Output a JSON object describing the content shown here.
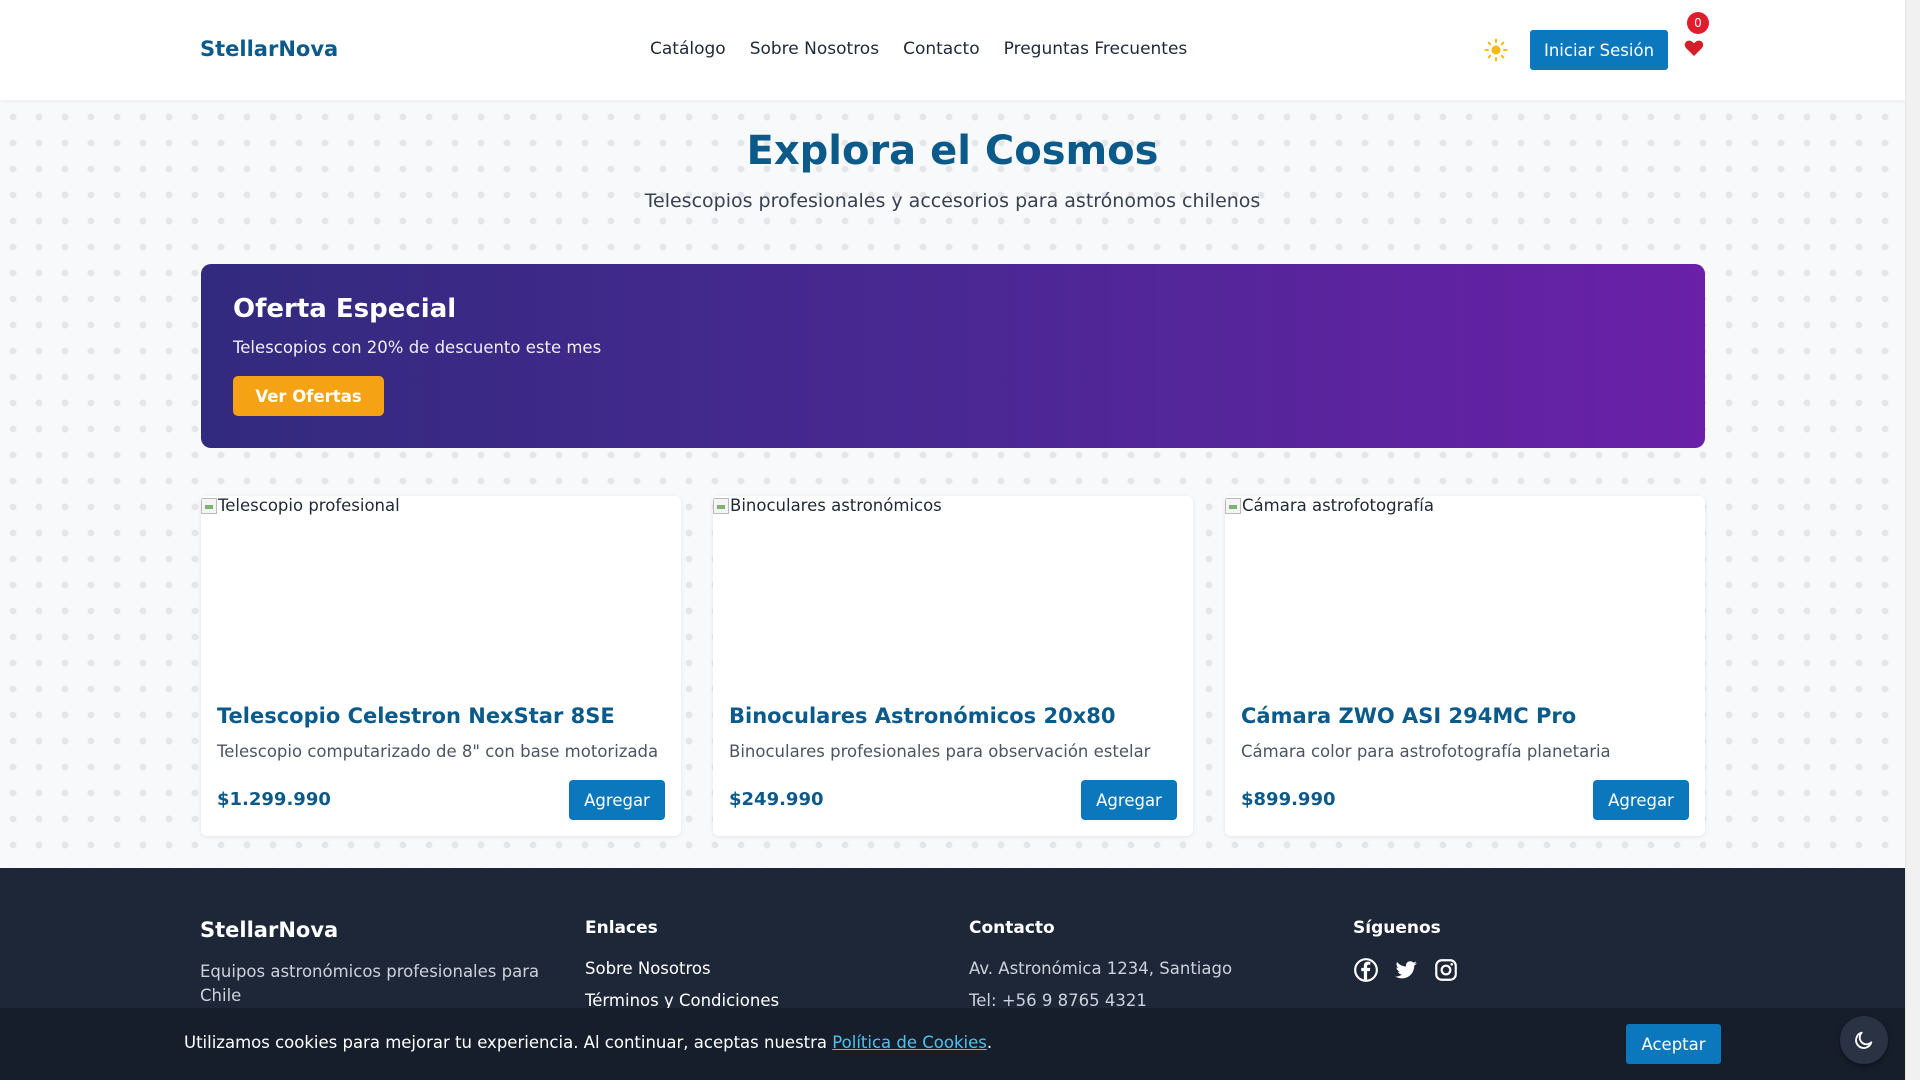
{
  "header": {
    "logo": "StellarNova",
    "nav": [
      "Catálogo",
      "Sobre Nosotros",
      "Contacto",
      "Preguntas Frecuentes"
    ],
    "login_label": "Iniciar Sesión",
    "favorites_count": "0",
    "theme_icon": "sun-icon"
  },
  "hero": {
    "title": "Explora el Cosmos",
    "subtitle": "Telescopios profesionales y accesorios para astrónomos chilenos"
  },
  "offer": {
    "title": "Oferta Especial",
    "text": "Telescopios con 20% de descuento este mes",
    "button": "Ver Ofertas"
  },
  "products": [
    {
      "image_alt": "Telescopio profesional",
      "title": "Telescopio Celestron NexStar 8SE",
      "description": "Telescopio computarizado de 8\" con base motorizada",
      "price": "$1.299.990",
      "button": "Agregar"
    },
    {
      "image_alt": "Binoculares astronómicos",
      "title": "Binoculares Astronómicos 20x80",
      "description": "Binoculares profesionales para observación estelar",
      "price": "$249.990",
      "button": "Agregar"
    },
    {
      "image_alt": "Cámara astrofotografía",
      "title": "Cámara ZWO ASI 294MC Pro",
      "description": "Cámara color para astrofotografía planetaria",
      "price": "$899.990",
      "button": "Agregar"
    }
  ],
  "footer": {
    "brand": "StellarNova",
    "description": "Equipos astronómicos profesionales para Chile",
    "links_title": "Enlaces",
    "links": [
      "Sobre Nosotros",
      "Términos y Condiciones"
    ],
    "contact_title": "Contacto",
    "contact": [
      "Av. Astronómica 1234, Santiago",
      "Tel: +56 9 8765 4321"
    ],
    "social_title": "Síguenos",
    "social_icons": [
      "facebook-icon",
      "twitter-icon",
      "instagram-icon"
    ]
  },
  "cookie": {
    "text": "Utilizamos cookies para mejorar tu experiencia. Al continuar, aceptas nuestra ",
    "link": "Política de Cookies",
    "suffix": ".",
    "button": "Aceptar"
  },
  "colors": {
    "brand": "#0b5a8a",
    "primary_button": "#0b77bd",
    "offer_button": "#f5a214",
    "badge": "#e21c2c",
    "footer": "#1e2738"
  }
}
